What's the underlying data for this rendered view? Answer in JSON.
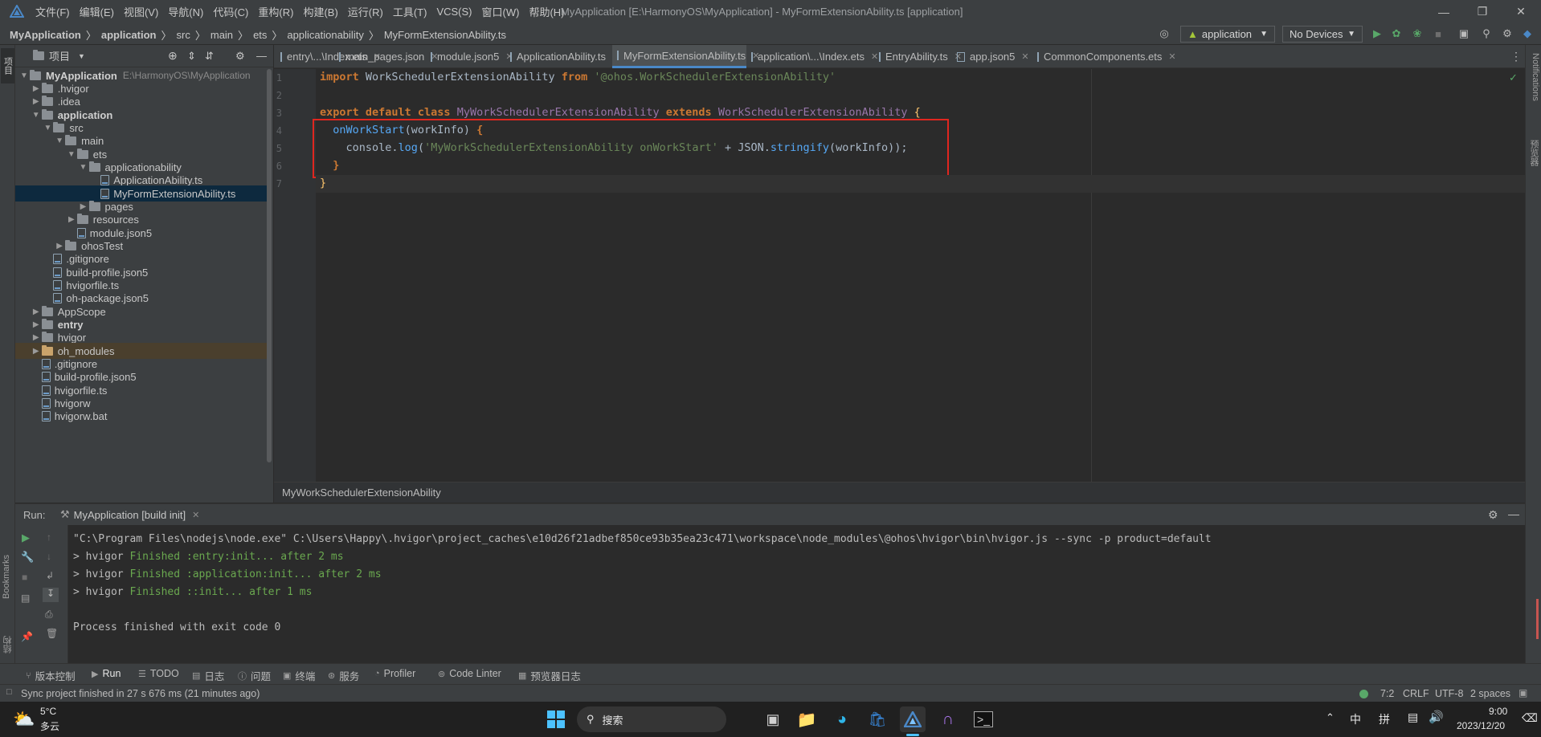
{
  "titlebar": {
    "menu": [
      "文件(F)",
      "编辑(E)",
      "视图(V)",
      "导航(N)",
      "代码(C)",
      "重构(R)",
      "构建(B)",
      "运行(R)",
      "工具(T)",
      "VCS(S)",
      "窗口(W)",
      "帮助(H)"
    ],
    "title": "MyApplication [E:\\HarmonyOS\\MyApplication] - MyFormExtensionAbility.ts [application]"
  },
  "navbar": {
    "crumbs": [
      "MyApplication",
      "application",
      "src",
      "main",
      "ets",
      "applicationability",
      "MyFormExtensionAbility.ts"
    ],
    "run_config": "application",
    "device": "No Devices"
  },
  "stripes": {
    "left_top": "项目",
    "left_bottom1": "Bookmarks",
    "left_bottom2": "结构",
    "right_top": "Notifications",
    "right_mid": "预览器"
  },
  "project": {
    "header": "项目",
    "items": [
      {
        "label": "MyApplication",
        "suffix": "E:\\HarmonyOS\\MyApplication",
        "depth": 0,
        "type": "folder",
        "open": true,
        "bold": true
      },
      {
        "label": ".hvigor",
        "depth": 1,
        "type": "folder",
        "open": false
      },
      {
        "label": ".idea",
        "depth": 1,
        "type": "folder",
        "open": false
      },
      {
        "label": "application",
        "depth": 1,
        "type": "folder",
        "open": true,
        "bold": true
      },
      {
        "label": "src",
        "depth": 2,
        "type": "folder",
        "open": true
      },
      {
        "label": "main",
        "depth": 3,
        "type": "folder",
        "open": true
      },
      {
        "label": "ets",
        "depth": 4,
        "type": "folder",
        "open": true
      },
      {
        "label": "applicationability",
        "depth": 5,
        "type": "folder",
        "open": true
      },
      {
        "label": "ApplicationAbility.ts",
        "depth": 6,
        "type": "file"
      },
      {
        "label": "MyFormExtensionAbility.ts",
        "depth": 6,
        "type": "file",
        "selected": true
      },
      {
        "label": "pages",
        "depth": 5,
        "type": "folder",
        "open": false
      },
      {
        "label": "resources",
        "depth": 4,
        "type": "folder",
        "open": false
      },
      {
        "label": "module.json5",
        "depth": 4,
        "type": "file"
      },
      {
        "label": "ohosTest",
        "depth": 3,
        "type": "folder",
        "open": false
      },
      {
        "label": ".gitignore",
        "depth": 2,
        "type": "file"
      },
      {
        "label": "build-profile.json5",
        "depth": 2,
        "type": "file"
      },
      {
        "label": "hvigorfile.ts",
        "depth": 2,
        "type": "file"
      },
      {
        "label": "oh-package.json5",
        "depth": 2,
        "type": "file"
      },
      {
        "label": "AppScope",
        "depth": 1,
        "type": "folder",
        "open": false
      },
      {
        "label": "entry",
        "depth": 1,
        "type": "folder",
        "open": false,
        "bold": true
      },
      {
        "label": "hvigor",
        "depth": 1,
        "type": "folder",
        "open": false
      },
      {
        "label": "oh_modules",
        "depth": 1,
        "type": "folder",
        "open": false,
        "highlight": true
      },
      {
        "label": ".gitignore",
        "depth": 1,
        "type": "file"
      },
      {
        "label": "build-profile.json5",
        "depth": 1,
        "type": "file"
      },
      {
        "label": "hvigorfile.ts",
        "depth": 1,
        "type": "file"
      },
      {
        "label": "hvigorw",
        "depth": 1,
        "type": "file"
      },
      {
        "label": "hvigorw.bat",
        "depth": 1,
        "type": "file"
      }
    ]
  },
  "tabs": [
    {
      "label": "entry\\...\\Index.ets"
    },
    {
      "label": "main_pages.json"
    },
    {
      "label": "module.json5"
    },
    {
      "label": "ApplicationAbility.ts"
    },
    {
      "label": "MyFormExtensionAbility.ts",
      "active": true
    },
    {
      "label": "application\\...\\Index.ets"
    },
    {
      "label": "EntryAbility.ts"
    },
    {
      "label": "app.json5"
    },
    {
      "label": "CommonComponents.ets"
    }
  ],
  "editor": {
    "line_numbers": [
      "1",
      "2",
      "3",
      "4",
      "5",
      "6",
      "7"
    ],
    "lines": [
      [
        {
          "t": "import ",
          "c": "kw"
        },
        {
          "t": "WorkSchedulerExtensionAbility ",
          "c": "plain"
        },
        {
          "t": "from ",
          "c": "kw"
        },
        {
          "t": "'@ohos.WorkSchedulerExtensionAbility'",
          "c": "str"
        }
      ],
      [],
      [
        {
          "t": "export default class ",
          "c": "kw"
        },
        {
          "t": "MyWorkSchedulerExtensionAbility ",
          "c": "cls"
        },
        {
          "t": "extends ",
          "c": "kw"
        },
        {
          "t": "WorkSchedulerExtensionAbility ",
          "c": "cls"
        },
        {
          "t": "{",
          "c": "fn"
        }
      ],
      [
        {
          "t": "  ",
          "c": "plain"
        },
        {
          "t": "onWorkStart",
          "c": "call"
        },
        {
          "t": "(workInfo) ",
          "c": "plain"
        },
        {
          "t": "{",
          "c": "kw"
        }
      ],
      [
        {
          "t": "    console.",
          "c": "plain"
        },
        {
          "t": "log",
          "c": "call"
        },
        {
          "t": "(",
          "c": "plain"
        },
        {
          "t": "'MyWorkSchedulerExtensionAbility onWorkStart' ",
          "c": "str"
        },
        {
          "t": "+ JSON.",
          "c": "plain"
        },
        {
          "t": "stringify",
          "c": "call"
        },
        {
          "t": "(workInfo));",
          "c": "plain"
        }
      ],
      [
        {
          "t": "  }",
          "c": "kw"
        }
      ],
      [
        {
          "t": "}",
          "c": "fn"
        }
      ]
    ],
    "breadcrumb": "MyWorkSchedulerExtensionAbility"
  },
  "run": {
    "label": "Run:",
    "tab": "MyApplication [build init]",
    "console": [
      {
        "text": "\"C:\\Program Files\\nodejs\\node.exe\" C:\\Users\\Happy\\.hvigor\\project_caches\\e10d26f21adbef850ce93b35ea23c471\\workspace\\node_modules\\@ohos\\hvigor\\bin\\hvigor.js --sync -p product=default"
      },
      {
        "prefix": "> hvigor ",
        "text": "Finished :entry:init... after 2 ms"
      },
      {
        "prefix": "> hvigor ",
        "text": "Finished :application:init... after 2 ms"
      },
      {
        "prefix": "> hvigor ",
        "text": "Finished ::init... after 1 ms"
      },
      {
        "text": ""
      },
      {
        "text": "Process finished with exit code 0"
      }
    ]
  },
  "bottombar": {
    "items": [
      "版本控制",
      "Run",
      "TODO",
      "日志",
      "问题",
      "终端",
      "服务",
      "Profiler",
      "Code Linter",
      "预览器日志"
    ]
  },
  "status": {
    "message": "Sync project finished in 27 s 676 ms (21 minutes ago)",
    "position": "7:2",
    "line_sep": "CRLF",
    "encoding": "UTF-8",
    "indent": "2 spaces"
  },
  "taskbar": {
    "temp": "5°C",
    "weather": "多云",
    "search": "搜索",
    "ime1": "中",
    "ime2": "拼",
    "time": "9:00",
    "date": "2023/12/20"
  },
  "colors": {
    "accent": "#4a88c7",
    "selection": "#0d293e",
    "red_box": "#e0261f"
  }
}
